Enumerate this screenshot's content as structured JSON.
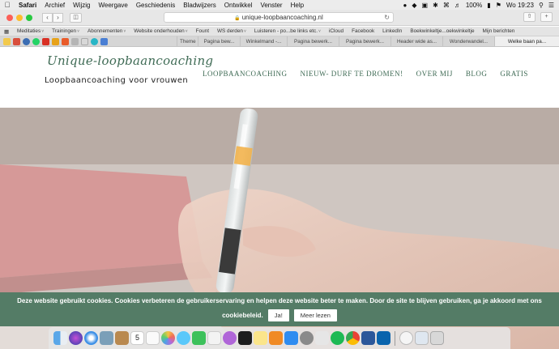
{
  "menubar": {
    "apple_icon": "apple-logo-icon",
    "app_name": "Safari",
    "items": [
      "Archief",
      "Wijzig",
      "Weergave",
      "Geschiedenis",
      "Bladwijzers",
      "Ontwikkel",
      "Venster",
      "Help"
    ],
    "battery": "100%",
    "clock": "Wo 19:23"
  },
  "toolbar": {
    "url": "unique-loopbaancoaching.nl",
    "back_icon": "chevron-left-icon",
    "forward_icon": "chevron-right-icon",
    "sidebar_icon": "sidebar-icon",
    "reload_icon": "reload-icon",
    "share_icon": "share-icon",
    "tabs_icon": "new-tab-icon"
  },
  "favorites": [
    "Meditaties",
    "Trainingen",
    "Abonnementen",
    "Website onderhouden",
    "Fount",
    "WS derden",
    "Luisteren - po...be links etc.",
    "iCloud",
    "Facebook",
    "LinkedIn",
    "Boekwinkeltje...oekwinkeltje",
    "Mijn berichten"
  ],
  "tabs": [
    "Theme",
    "Pagina bew...",
    "Winkelmand -...",
    "Pagina bewerk...",
    "Pagina bewerk...",
    "Header wide as...",
    "Wonderwandel...",
    "Welke baan pa..."
  ],
  "site": {
    "logo_script": "Unique-loopbaancoaching",
    "logo_tagline": "Loopbaancoaching voor vrouwen",
    "nav": [
      "LOOPBAANCOACHING",
      "NIEUW- DURF TE DROMEN!",
      "OVER MIJ",
      "BLOG",
      "GRATIS"
    ]
  },
  "cookie": {
    "message_line1": "Deze website gebruikt cookies. Cookies verbeteren de gebruikerservaring en helpen deze website beter te maken. Door de site te blijven gebruiken, ga je akkoord met ons",
    "message_line2": "cookiebeleid.",
    "accept_label": "Ja!",
    "more_label": "Meer lezen"
  },
  "colors": {
    "brand_green": "#3f6b55",
    "cookie_bg": "#547c66"
  },
  "dock": {
    "apps": [
      "finder-icon",
      "siri-icon",
      "safari-icon",
      "mail-icon",
      "notes-book-icon",
      "calendar-icon",
      "reminders-icon",
      "photos-icon",
      "messages-icon",
      "facetime-icon",
      "music-icon",
      "podcasts-icon",
      "tv-icon",
      "notes-icon",
      "books-icon",
      "app-store-icon",
      "system-preferences-icon",
      "spotify-icon",
      "chrome-icon",
      "word-icon",
      "outlook-icon",
      "downloads-icon",
      "documents-icon",
      "trash-icon"
    ],
    "calendar_day": "5"
  }
}
